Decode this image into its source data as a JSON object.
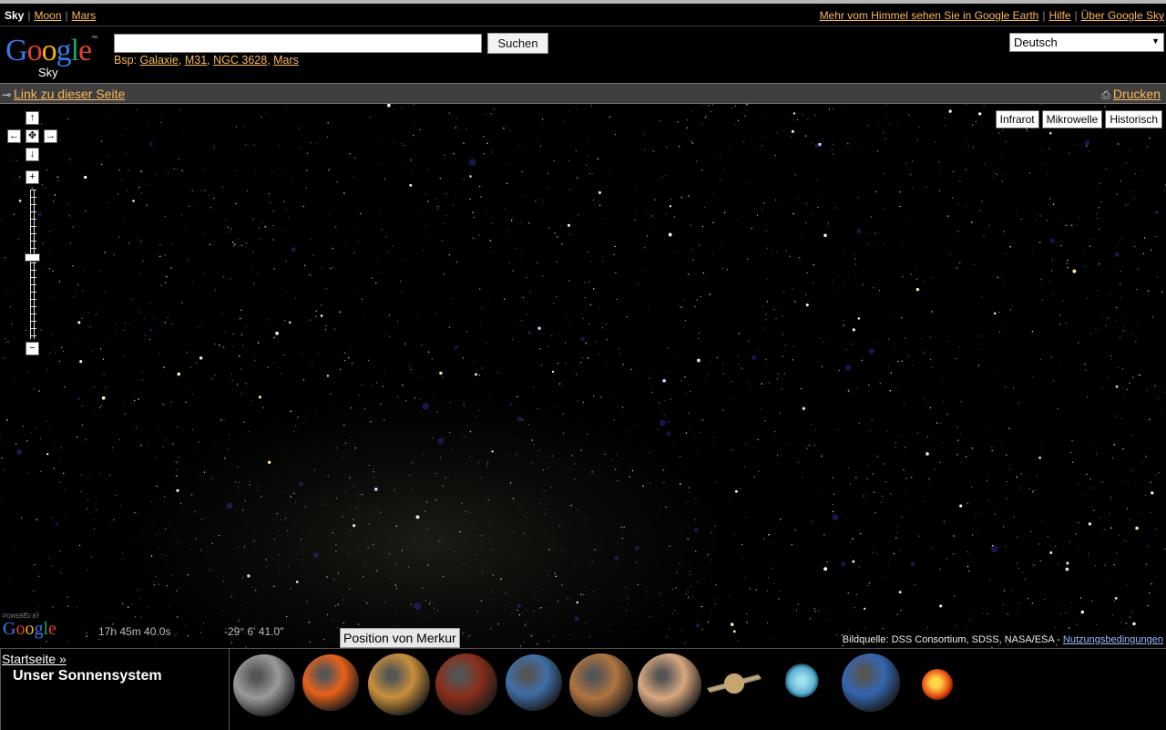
{
  "topnav": {
    "current": "Sky",
    "links": [
      "Moon",
      "Mars"
    ],
    "right_links": [
      "Mehr vom Himmel sehen Sie in Google Earth",
      "Hilfe",
      "Über Google Sky"
    ]
  },
  "logo": {
    "main": "Google",
    "tm": "™",
    "sub": "Sky"
  },
  "search": {
    "value": "",
    "button": "Suchen",
    "examples_prefix": "Bsp:",
    "examples": [
      "Galaxie",
      "M31",
      "NGC 3628",
      "Mars"
    ]
  },
  "language": {
    "selected": "Deutsch"
  },
  "linkbar": {
    "link_label": "Link zu dieser Seite",
    "print_label": "Drucken"
  },
  "map_controls": {
    "pan": {
      "up": "↑",
      "left": "←",
      "center": "✥",
      "right": "→",
      "down": "↓"
    },
    "zoom_in": "+",
    "zoom_out": "−",
    "zoom_level_fraction": 0.46
  },
  "layers": [
    "Infrarot",
    "Mikrowelle",
    "Historisch"
  ],
  "powered": {
    "label": "POWERED BY",
    "brand": "Google"
  },
  "coords": {
    "ra": "17h 45m 40.0s",
    "dec": "-29° 6' 41.0\""
  },
  "tooltip": "Position von Merkur",
  "credit": {
    "text": "Bildquelle: DSS Consortium, SDSS, NASA/ESA -",
    "link": "Nutzungsbedingungen"
  },
  "bottom": {
    "home_link": "Startseite »",
    "title": "Unser Sonnensystem",
    "planets": [
      {
        "name": "moon",
        "color": "#9a9a9a"
      },
      {
        "name": "sun",
        "color": "#e8611a"
      },
      {
        "name": "venus",
        "color": "#c98f3c"
      },
      {
        "name": "mercury",
        "color": "#8a2e1a"
      },
      {
        "name": "earth",
        "color": "#3f6ea8"
      },
      {
        "name": "mars",
        "color": "#b07440"
      },
      {
        "name": "jupiter",
        "color": "#d8a880"
      },
      {
        "name": "saturn",
        "color": "#c6a56e"
      },
      {
        "name": "uranus",
        "color": "#5fb0cf"
      },
      {
        "name": "neptune",
        "color": "#3466b0"
      },
      {
        "name": "pluto",
        "color": "#e85010"
      }
    ]
  },
  "colors": {
    "link": "#f9b95a",
    "linkbar_bg": "#3f3f3f",
    "background": "#000000"
  }
}
